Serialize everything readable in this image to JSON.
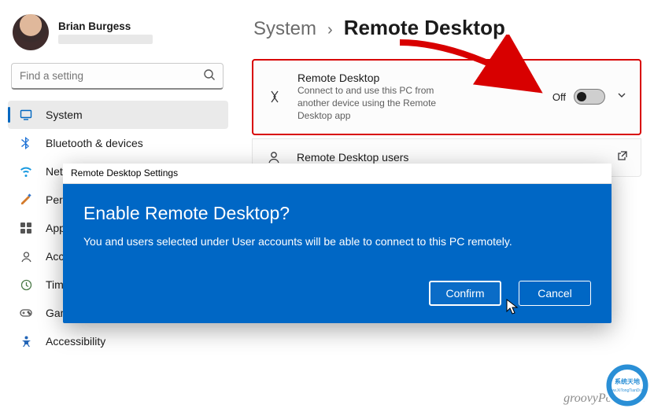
{
  "user": {
    "name": "Brian Burgess"
  },
  "search": {
    "placeholder": "Find a setting"
  },
  "nav": {
    "system": "System",
    "bluetooth": "Bluetooth & devices",
    "network": "Network & internet",
    "personalization": "Personalization",
    "apps": "Apps",
    "accounts": "Accounts",
    "time": "Time & language",
    "gaming": "Gaming",
    "accessibility": "Accessibility"
  },
  "breadcrumb": {
    "parent": "System",
    "sep": "›",
    "page": "Remote Desktop"
  },
  "cards": {
    "rd": {
      "title": "Remote Desktop",
      "desc": "Connect to and use this PC from another device using the Remote Desktop app",
      "toggle_label": "Off"
    },
    "users": {
      "title": "Remote Desktop users"
    }
  },
  "dialog": {
    "titlebar": "Remote Desktop Settings",
    "heading": "Enable Remote Desktop?",
    "text": "You and users selected under User accounts will be able to connect to this PC remotely.",
    "confirm": "Confirm",
    "cancel": "Cancel"
  },
  "watermark": "groovyPost.com"
}
